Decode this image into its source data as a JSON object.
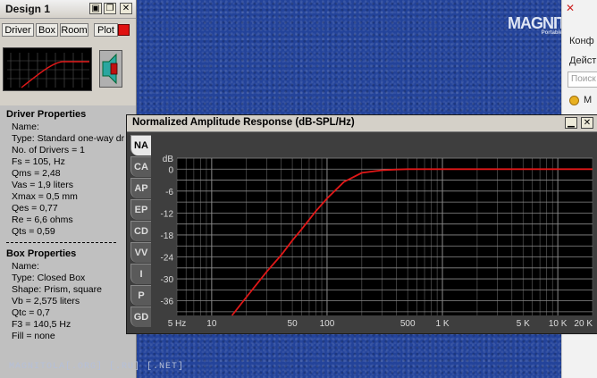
{
  "desktop": {
    "logo_text": "MAGNIT",
    "logo_mark": "O",
    "logo_sub": "Portable Audio",
    "footer": "MAGNITOLA[.ORG] [.RU] [.NET]"
  },
  "browser_strip": {
    "line1": "Конф",
    "line2": "Дейст",
    "search_placeholder": "Поиск",
    "item": "М"
  },
  "design_window": {
    "title": "Design 1",
    "tabs": [
      "Driver",
      "Box",
      "Room",
      "Plot"
    ],
    "driver_heading": "Driver Properties",
    "driver_lines": [
      "Name:",
      "Type: Standard one-way dr",
      "No. of Drivers = 1",
      "Fs = 105, Hz",
      "Qms = 2,48",
      "Vas = 1,9 liters",
      "Xmax = 0,5 mm",
      "Qes = 0,77",
      "Re = 6,6 ohms",
      "Qts = 0,59"
    ],
    "box_heading": "Box Properties",
    "box_lines": [
      "Name:",
      "Type: Closed Box",
      "Shape: Prism, square",
      "Vb = 2,575 liters",
      "Qtc = 0,7",
      "F3 = 140,5 Hz",
      "Fill = none"
    ]
  },
  "graph_window": {
    "title": "Normalized Amplitude Response (dB-SPL/Hz)",
    "side_tabs": [
      "NA",
      "CA",
      "AP",
      "EP",
      "CD",
      "VV",
      "I",
      "P",
      "GD"
    ],
    "active_tab": "NA"
  },
  "chart_data": {
    "type": "line",
    "title": "Normalized Amplitude Response (dB-SPL/Hz)",
    "xscale": "log",
    "xlim": [
      5,
      20000
    ],
    "ylim": [
      -40,
      0
    ],
    "y_unit_label": "dB",
    "x_ticks": [
      {
        "v": 5,
        "label": "5 Hz"
      },
      {
        "v": 10,
        "label": "10"
      },
      {
        "v": 50,
        "label": "50"
      },
      {
        "v": 100,
        "label": "100"
      },
      {
        "v": 500,
        "label": "500"
      },
      {
        "v": 1000,
        "label": "1 K"
      },
      {
        "v": 5000,
        "label": "5 K"
      },
      {
        "v": 10000,
        "label": "10 K"
      },
      {
        "v": 20000,
        "label": "20 K"
      }
    ],
    "y_ticks": [
      {
        "v": 0,
        "label": "0"
      },
      {
        "v": -6,
        "label": "-6"
      },
      {
        "v": -12,
        "label": "-12"
      },
      {
        "v": -18,
        "label": "-18"
      },
      {
        "v": -24,
        "label": "-24"
      },
      {
        "v": -30,
        "label": "-30"
      },
      {
        "v": -36,
        "label": "-36"
      }
    ],
    "y_grid_extra": [
      3,
      -3,
      -9,
      -15,
      -21,
      -27,
      -33,
      -39
    ],
    "grid": true,
    "line_color": "#e01818",
    "series": [
      {
        "x": [
          15,
          20,
          30,
          40,
          50,
          60,
          80,
          100,
          140,
          200,
          300,
          400,
          500,
          1000,
          5000,
          20000
        ],
        "y": [
          -40,
          -35,
          -28,
          -23.5,
          -19.5,
          -16.5,
          -11.5,
          -8,
          -3.5,
          -1,
          -0.3,
          -0.1,
          0,
          0,
          0,
          0
        ]
      }
    ]
  },
  "colors": {
    "desktop_blue": "#23439a",
    "graph_bg": "#000000",
    "grid_major": "#8a8a8a",
    "grid_minor": "#4a4a4a",
    "accent_red": "#e01010"
  }
}
